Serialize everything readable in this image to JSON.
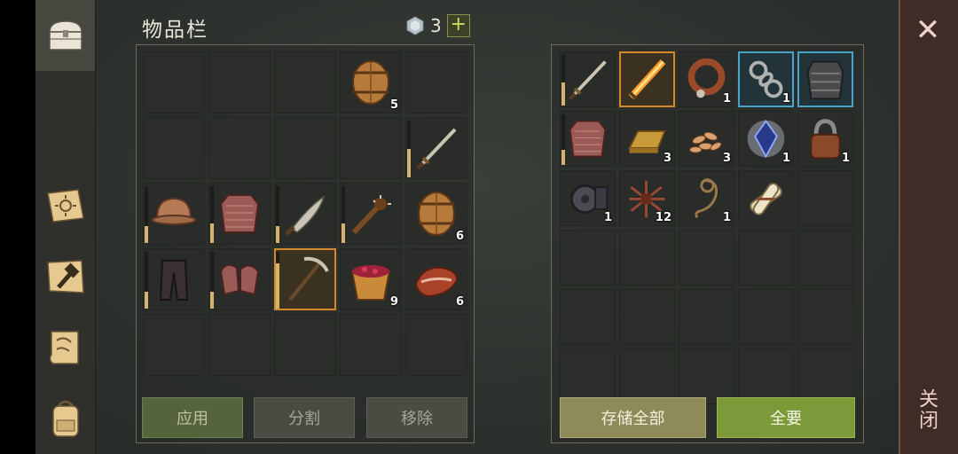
{
  "header": {
    "title": "物品栏",
    "gem_count": "3",
    "add_label": "+"
  },
  "inventory": {
    "slots": [
      {
        "item": null
      },
      {
        "item": null
      },
      {
        "item": null
      },
      {
        "item": "barrel",
        "qty": "5"
      },
      {
        "item": null
      },
      {
        "item": null
      },
      {
        "item": null
      },
      {
        "item": null
      },
      {
        "item": null
      },
      {
        "item": "sword",
        "dura": 0.5
      },
      {
        "item": "helmet",
        "dura": 0.3
      },
      {
        "item": "chainmail-armor",
        "dura": 0.35
      },
      {
        "item": "machete",
        "dura": 0.3
      },
      {
        "item": "spiked-club",
        "dura": 0.35
      },
      {
        "item": "barrel",
        "qty": "6"
      },
      {
        "item": "leather-pants",
        "dura": 0.3
      },
      {
        "item": "chainmail-gloves",
        "dura": 0.3
      },
      {
        "item": "pickaxe",
        "dura": 0.8,
        "selected": "orange"
      },
      {
        "item": "berry-bucket",
        "qty": "9"
      },
      {
        "item": "meat",
        "qty": "6"
      },
      {
        "item": null
      },
      {
        "item": null
      },
      {
        "item": null
      },
      {
        "item": null
      },
      {
        "item": null
      }
    ],
    "buttons": {
      "apply": "应用",
      "split": "分割",
      "remove": "移除"
    }
  },
  "storage": {
    "slots": [
      {
        "item": "sword",
        "dura": 0.45
      },
      {
        "item": "flaming-sword",
        "selected": "orange"
      },
      {
        "item": "dog-collar",
        "qty": "1"
      },
      {
        "item": "chain-shackles",
        "qty": "1",
        "selected": "blue"
      },
      {
        "item": "plate-armor",
        "selected": "blue"
      },
      {
        "item": "chainmail-armor",
        "dura": 0.3
      },
      {
        "item": "gold-bar",
        "qty": "3"
      },
      {
        "item": "seeds",
        "qty": "3"
      },
      {
        "item": "crystal",
        "qty": "1"
      },
      {
        "item": "padlock",
        "qty": "1"
      },
      {
        "item": "gear-mechanism",
        "qty": "1"
      },
      {
        "item": "nails-bundle",
        "qty": "12"
      },
      {
        "item": "rope",
        "qty": "1"
      },
      {
        "item": "scroll-bundle"
      },
      {
        "item": null
      },
      {
        "item": null
      },
      {
        "item": null
      },
      {
        "item": null
      },
      {
        "item": null
      },
      {
        "item": null
      },
      {
        "item": null
      },
      {
        "item": null
      },
      {
        "item": null
      },
      {
        "item": null
      },
      {
        "item": null
      },
      {
        "item": null
      },
      {
        "item": null
      },
      {
        "item": null
      },
      {
        "item": null
      },
      {
        "item": null
      }
    ],
    "buttons": {
      "store_all": "存储全部",
      "take_all": "全要"
    }
  },
  "close": {
    "label": "关闭",
    "x": "✕"
  },
  "sidebar": {
    "tabs": [
      "chest",
      "journal",
      "crafting",
      "map",
      "backpack"
    ]
  },
  "colors": {
    "accent_orange": "#d38a2a",
    "accent_blue": "#4aa3c9",
    "green_button": "#7d9a3b"
  }
}
